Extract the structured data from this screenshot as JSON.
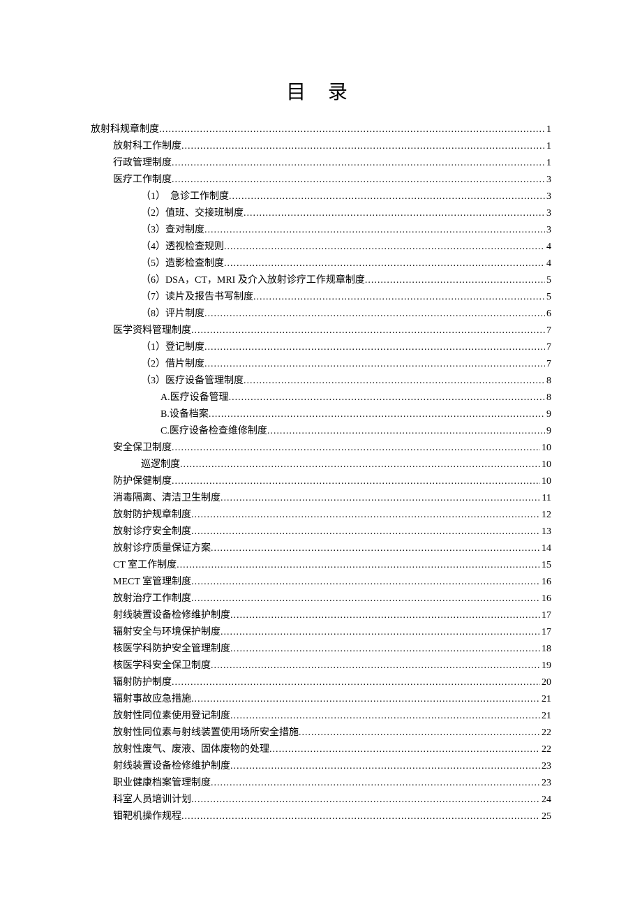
{
  "title": "目  录",
  "toc": [
    {
      "label": "放射科规章制度",
      "page": "1",
      "indent": 0
    },
    {
      "label": "放射科工作制度",
      "page": "1",
      "indent": 1
    },
    {
      "label": "行政管理制度",
      "page": "1",
      "indent": 1
    },
    {
      "label": "医疗工作制度",
      "page": "3",
      "indent": 1
    },
    {
      "label": "（1）　急诊工作制度",
      "page": "3",
      "indent": 2
    },
    {
      "label": "（2）值班、交接班制度",
      "page": "3",
      "indent": 2
    },
    {
      "label": "（3）查对制度",
      "page": "3",
      "indent": 2
    },
    {
      "label": "（4）透视检查规则",
      "page": "4",
      "indent": 2
    },
    {
      "label": "（5）造影检查制度",
      "page": "4",
      "indent": 2
    },
    {
      "label": "（6）DSA，CT，MRI 及介入放射诊疗工作规章制度",
      "page": "5",
      "indent": 2
    },
    {
      "label": "（7）读片及报告书写制度",
      "page": "5",
      "indent": 2
    },
    {
      "label": "（8）评片制度",
      "page": "6",
      "indent": 2
    },
    {
      "label": "医学资料管理制度",
      "page": "7",
      "indent": 1
    },
    {
      "label": "（1）登记制度",
      "page": "7",
      "indent": 2
    },
    {
      "label": "（2）借片制度",
      "page": "7",
      "indent": 2
    },
    {
      "label": "（3）医疗设备管理制度",
      "page": "8",
      "indent": 2
    },
    {
      "label": "A.医疗设备管理",
      "page": "8",
      "indent": 3
    },
    {
      "label": "B.设备档案",
      "page": "9",
      "indent": 3
    },
    {
      "label": "C.医疗设备检查维修制度",
      "page": "9",
      "indent": 3
    },
    {
      "label": "安全保卫制度",
      "page": "10",
      "indent": 1
    },
    {
      "label": "巡逻制度",
      "page": "10",
      "indent": 2
    },
    {
      "label": "防护保健制度",
      "page": "10",
      "indent": 1
    },
    {
      "label": "消毒隔离、清洁卫生制度",
      "page": "11",
      "indent": 1
    },
    {
      "label": "放射防护规章制度",
      "page": "12",
      "indent": 1
    },
    {
      "label": "放射诊疗安全制度",
      "page": "13",
      "indent": 1
    },
    {
      "label": "放射诊疗质量保证方案",
      "page": "14",
      "indent": 1
    },
    {
      "label": "CT 室工作制度",
      "page": "15",
      "indent": 1
    },
    {
      "label": "MECT 室管理制度",
      "page": "16",
      "indent": 1
    },
    {
      "label": "放射治疗工作制度",
      "page": "16",
      "indent": 1
    },
    {
      "label": "射线装置设备检修维护制度",
      "page": "17",
      "indent": 1
    },
    {
      "label": "辐射安全与环境保护制度",
      "page": "17",
      "indent": 1
    },
    {
      "label": "核医学科防护安全管理制度",
      "page": "18",
      "indent": 1
    },
    {
      "label": "核医学科安全保卫制度",
      "page": "19",
      "indent": 1
    },
    {
      "label": "辐射防护制度",
      "page": "20",
      "indent": 1
    },
    {
      "label": "辐射事故应急措施",
      "page": "21",
      "indent": 1
    },
    {
      "label": "放射性同位素使用登记制度",
      "page": "21",
      "indent": 1
    },
    {
      "label": "放射性同位素与射线装置使用场所安全措施",
      "page": "22",
      "indent": 1
    },
    {
      "label": "放射性废气、废液、固体废物的处理",
      "page": "22",
      "indent": 1
    },
    {
      "label": "射线装置设备检修维护制度",
      "page": "23",
      "indent": 1
    },
    {
      "label": "职业健康档案管理制度",
      "page": "23",
      "indent": 1
    },
    {
      "label": "科室人员培训计划",
      "page": "24",
      "indent": 1
    },
    {
      "label": "钼靶机操作规程",
      "page": "25",
      "indent": 1
    }
  ]
}
